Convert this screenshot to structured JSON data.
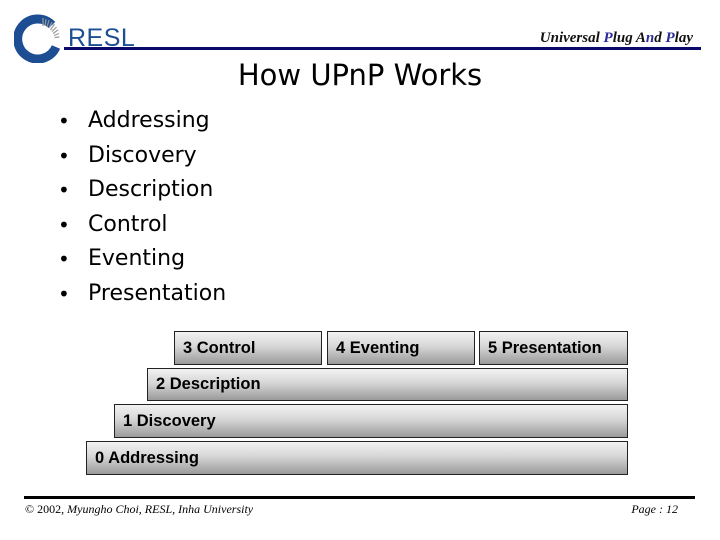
{
  "header": {
    "logo_text": "RESL",
    "logo_color": "#1d4e93",
    "title_parts": [
      {
        "text": "Universal ",
        "accent": false
      },
      {
        "text": "P",
        "accent": true
      },
      {
        "text": "lug A",
        "accent": false
      },
      {
        "text": "n",
        "accent": true
      },
      {
        "text": "d ",
        "accent": false
      },
      {
        "text": "P",
        "accent": true
      },
      {
        "text": "lay",
        "accent": false
      }
    ]
  },
  "slide": {
    "title": "How UPnP Works",
    "bullet_glyph": "•",
    "bullets": [
      "Addressing",
      "Discovery",
      "Description",
      "Control",
      "Eventing",
      "Presentation"
    ]
  },
  "diagram": {
    "layers": [
      {
        "label": "3 Control"
      },
      {
        "label": "4 Eventing"
      },
      {
        "label": "5 Presentation"
      },
      {
        "label": "2 Description"
      },
      {
        "label": "1 Discovery"
      },
      {
        "label": "0 Addressing"
      }
    ]
  },
  "footer": {
    "copyright": "© 2002,",
    "author": " Myungho Choi, RESL, Inha University",
    "page": "Page : 12"
  }
}
